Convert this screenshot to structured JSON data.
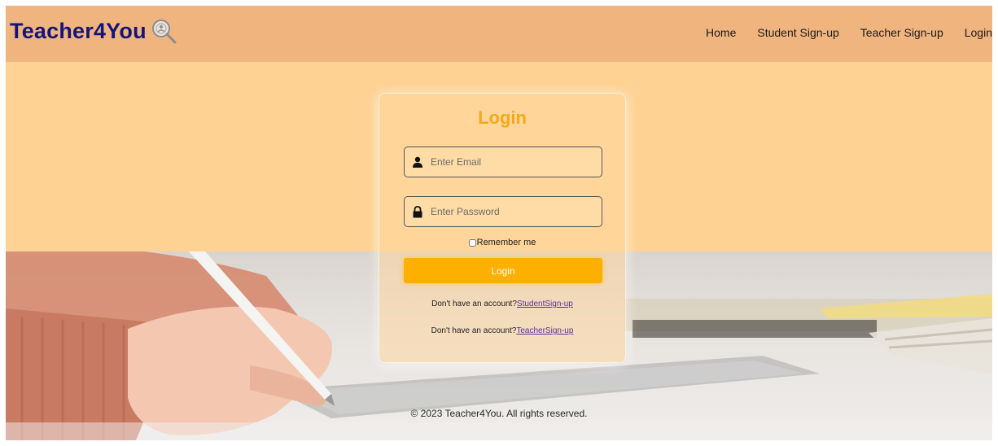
{
  "brand": {
    "name": "Teacher4You",
    "icon": "magnifier-logo-icon",
    "color": "#151579"
  },
  "nav": {
    "items": [
      {
        "label": "Home"
      },
      {
        "label": "Student Sign-up"
      },
      {
        "label": "Teacher Sign-up"
      },
      {
        "label": "Login"
      }
    ]
  },
  "login": {
    "title": "Login",
    "email_placeholder": "Enter Email",
    "password_placeholder": "Enter Password",
    "remember_label": "Remember me",
    "button_label": "Login",
    "student_prompt": "Don't have an account?",
    "student_link": "StudentSign-up",
    "teacher_prompt": "Don't have an account?",
    "teacher_link": "TeacherSign-up"
  },
  "footer": {
    "copyright": "© 2023 Teacher4You. All rights reserved."
  },
  "colors": {
    "navbar": "#f0b47e",
    "hero": "#fed293",
    "accent": "#fdb000",
    "title": "#f2aa18",
    "link": "#5b2fa6"
  }
}
